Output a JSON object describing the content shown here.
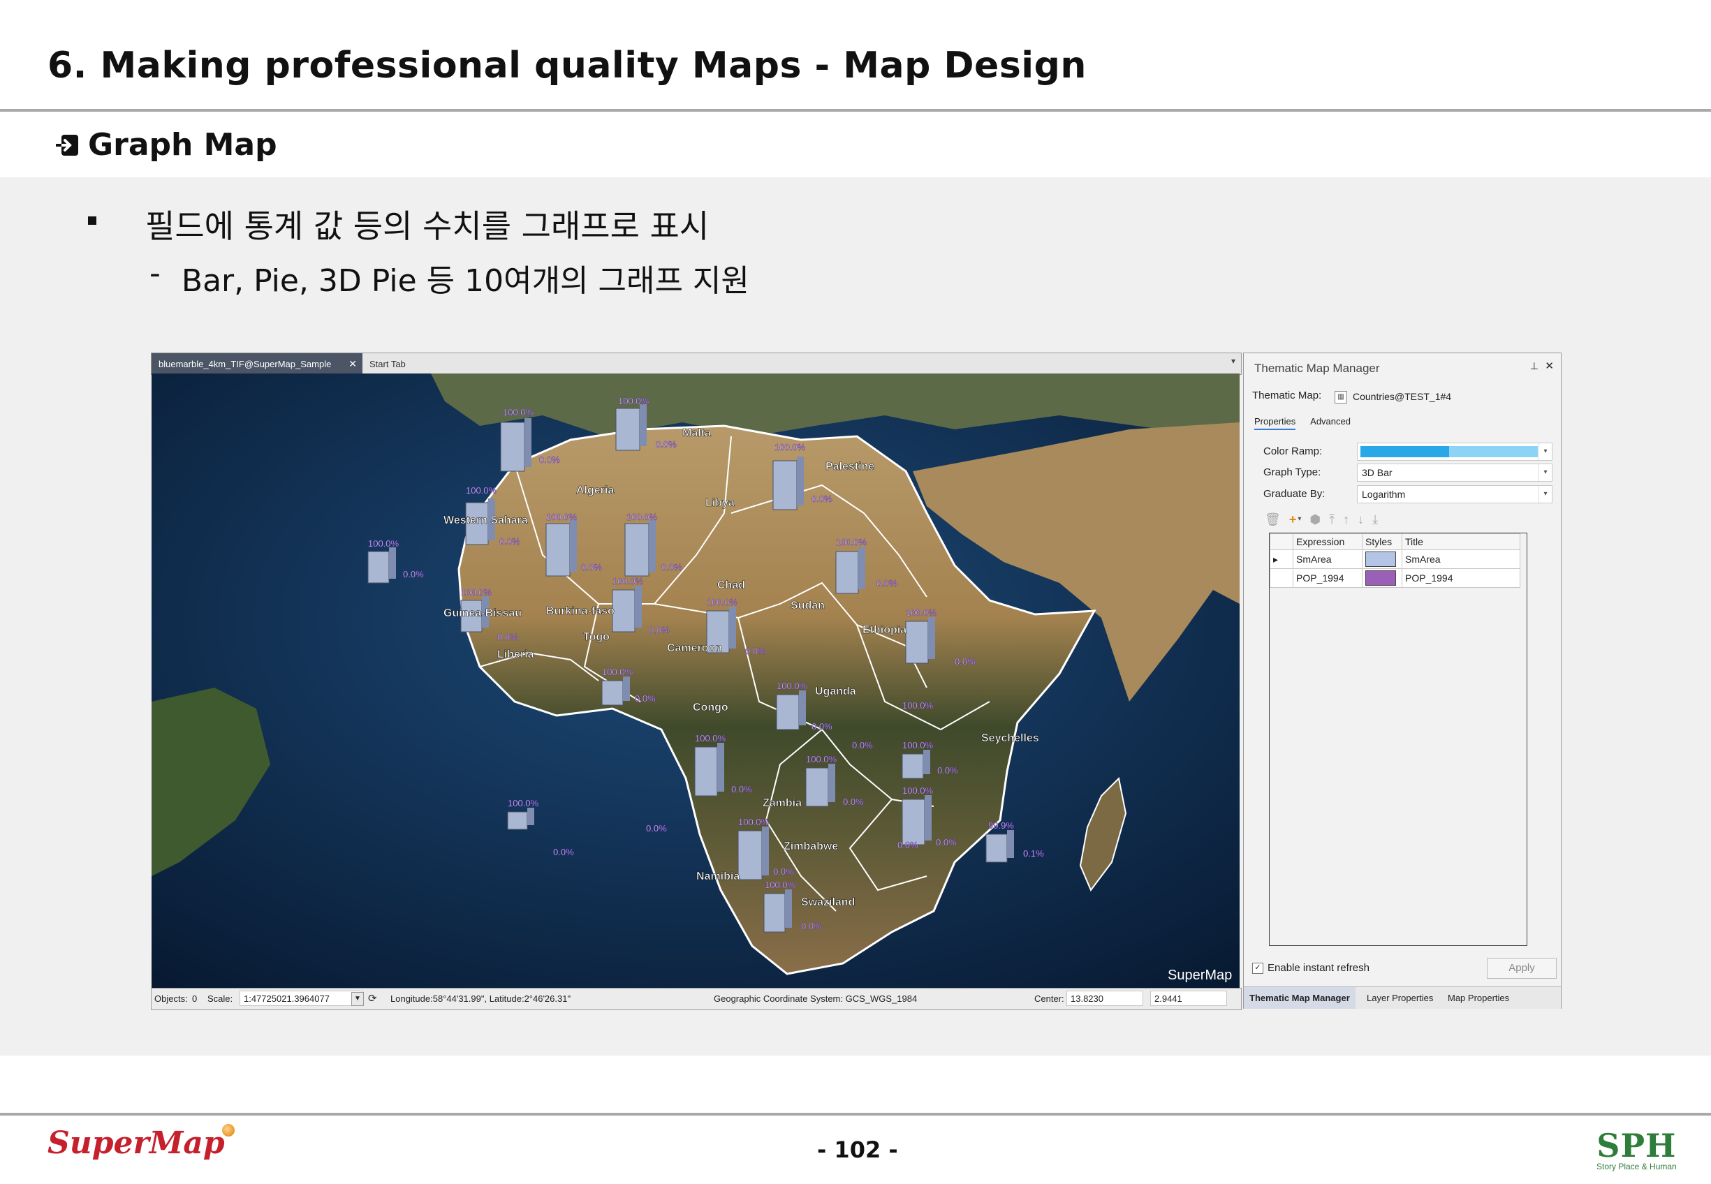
{
  "slide": {
    "title": "6. Making professional quality Maps - Map Design",
    "section": "Graph Map",
    "bullet": "필드에 통계 값 등의 수치를 그래프로 표시",
    "sub_dash": "-",
    "sub_bullet": "Bar, Pie, 3D Pie 등 10여개의 그래프 지원",
    "page_number": "- 102 -",
    "left_logo": "SuperMap",
    "right_logo": "SPH",
    "right_logo_tagline": "Story Place & Human"
  },
  "window": {
    "tabs": [
      {
        "label": "bluemarble_4km_TIF@SuperMap_Sample",
        "active": true,
        "close": "✕"
      },
      {
        "label": "Start Tab",
        "active": false
      }
    ],
    "tab_dropdown": "▾"
  },
  "map": {
    "watermark": "SuperMap",
    "country_labels": [
      "Malta",
      "Palestine",
      "Algeria",
      "Libya",
      "Western Sahara",
      "Chad",
      "Sudan",
      "Guinea-Bissau",
      "Burkina-faso",
      "Togo",
      "Ethiopia",
      "Liberia",
      "Cameroon",
      "Uganda",
      "Congo",
      "Seychelles",
      "Zambia",
      "Zimbabwe",
      "Namibia",
      "Swaziland"
    ],
    "bar_labels": [
      "100.0%",
      "100.0%",
      "0.0%",
      "0.0%",
      "100.0%",
      "0.0%",
      "100.0%",
      "100.0%",
      "100.0%",
      "0.0%",
      "100.0%",
      "0.0%",
      "0.0%",
      "0.0%",
      "100.0%",
      "0.0%",
      "100.0%",
      "0.0%",
      "100.0%",
      "0.0%",
      "100.0%",
      "0.0%",
      "0.0%",
      "100.0%",
      "0.0%",
      "0.0%",
      "100.0%",
      "0.0%",
      "100.0%",
      "0.0%",
      "100.0%",
      "0.0%",
      "100.0%",
      "0.0%",
      "100.0%",
      "0.0%",
      "100.0%",
      "0.0%",
      "99.9%",
      "0.1%",
      "0.0%",
      "100.0%",
      "0.0%",
      "100.0%",
      "0.0%",
      "100.0%",
      "0.0%",
      "100.0%"
    ]
  },
  "status": {
    "objects_label": "Objects:",
    "objects_value": "0",
    "scale_label": "Scale:",
    "scale_value": "1:47725021.3964077",
    "coords": "Longitude:58°44'31.99\", Latitude:2°46'26.31\"",
    "crs": "Geographic Coordinate System: GCS_WGS_1984",
    "center_label": "Center:",
    "center_x": "13.8230",
    "center_y": "2.9441"
  },
  "panel": {
    "title": "Thematic Map Manager",
    "pin": "📌",
    "close": "✕",
    "thematic_map_label": "Thematic Map:",
    "thematic_map_value": "Countries@TEST_1#4",
    "tabs": [
      "Properties",
      "Advanced"
    ],
    "color_ramp_label": "Color Ramp:",
    "color_ramp_colors": [
      "#29a8e8",
      "#8dd3f5"
    ],
    "graph_type_label": "Graph Type:",
    "graph_type_value": "3D Bar",
    "graduate_by_label": "Graduate By:",
    "graduate_by_value": "Logarithm",
    "toolbar": [
      "🗑",
      "+",
      "▾",
      "⬢",
      "⤒",
      "↑",
      "↓",
      "⤓"
    ],
    "table": {
      "headers": [
        "Expression",
        "Styles",
        "Title"
      ],
      "rows": [
        {
          "expression": "SmArea",
          "style_color": "#b4c4e4",
          "title": "SmArea"
        },
        {
          "expression": "POP_1994",
          "style_color": "#9b5fb8",
          "title": "POP_1994"
        }
      ]
    },
    "row_marker": "▸",
    "enable_refresh": "Enable instant refresh",
    "apply": "Apply",
    "bottom_tabs": [
      "Thematic Map Manager",
      "Layer Properties",
      "Map Properties"
    ]
  },
  "colors": {
    "ocean": "#0d2a4e",
    "land": "#9a7a4e",
    "border": "#ffffff",
    "bar_fill": "#a9b7d2",
    "bar_accent": "#7b3fb0"
  }
}
